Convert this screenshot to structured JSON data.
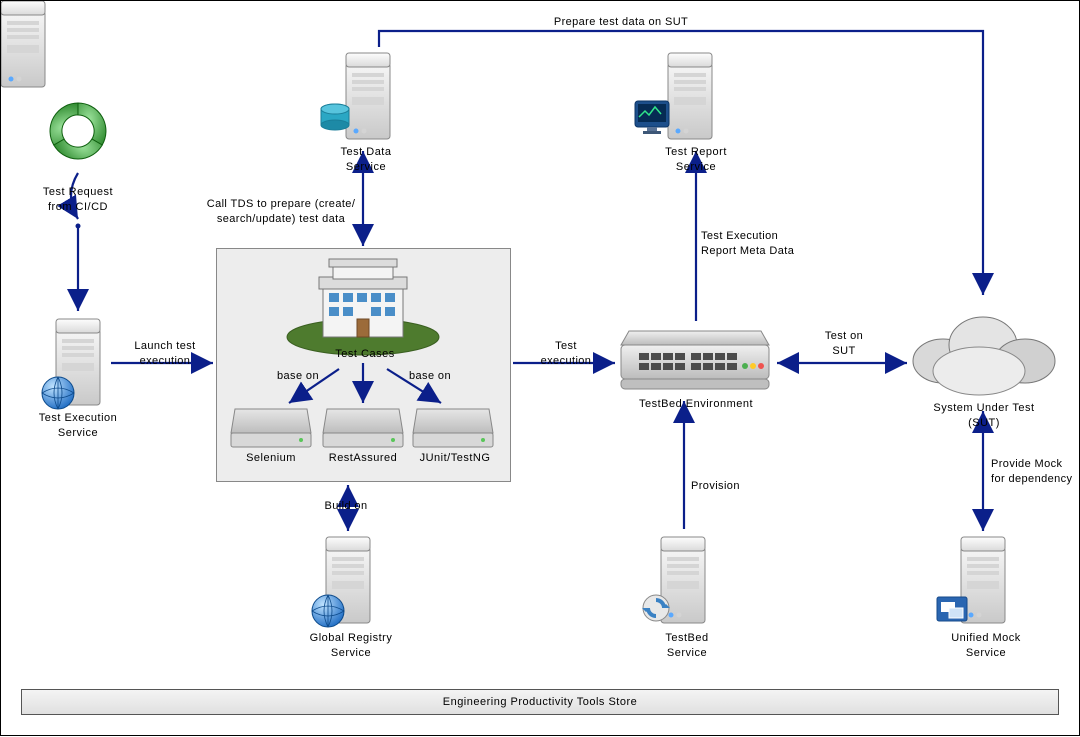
{
  "nodes": {
    "test_request": "Test Request\nfrom CI/CD",
    "test_execution_service": "Test Execution\nService",
    "test_data_service": "Test Data\nService",
    "test_cases": "Test Cases",
    "selenium": "Selenium",
    "restassured": "RestAssured",
    "junit_testng": "JUnit/TestNG",
    "test_report_service": "Test Report\nService",
    "testbed_env": "TestBed Environment",
    "sut": "System Under Test\n(SUT)",
    "global_registry": "Global Registry\nService",
    "testbed_service": "TestBed\nService",
    "unified_mock": "Unified Mock\nService"
  },
  "edges": {
    "launch_test": "Launch test\nexecution",
    "call_tds": "Call TDS to prepare (create/\nsearch/update) test data",
    "base_on_left": "base on",
    "base_on_right": "base on",
    "test_execution": "Test\nexecution",
    "report_meta": "Test Execution\nReport Meta Data",
    "test_on_sut": "Test on\nSUT",
    "prepare_test_data": "Prepare test data on SUT",
    "build_on": "Build on",
    "provision": "Provision",
    "provide_mock": "Provide Mock\nfor dependency"
  },
  "footer": "Engineering Productivity Tools Store"
}
